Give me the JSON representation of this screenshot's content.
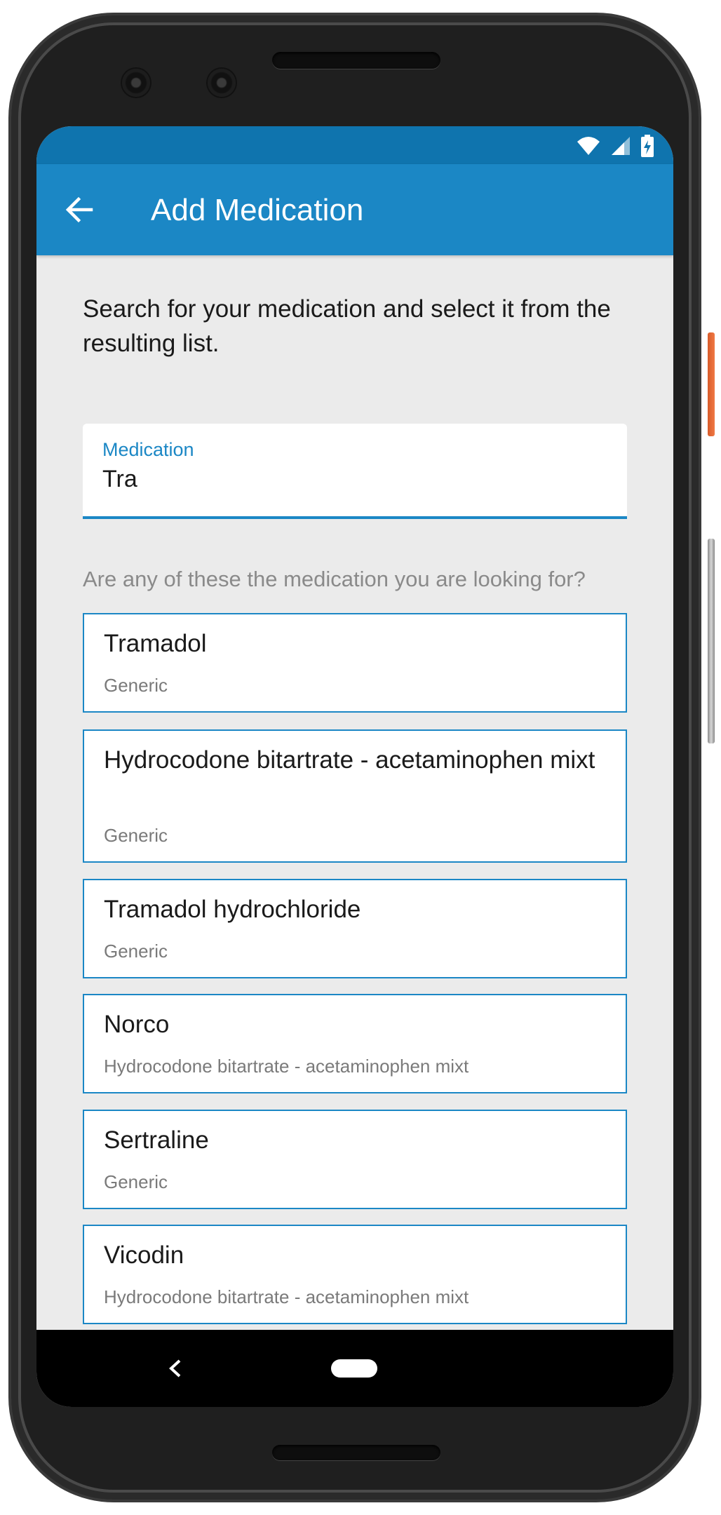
{
  "app_bar": {
    "title": "Add Medication",
    "back_icon": "arrow-left-icon"
  },
  "status_bar": {
    "icons": [
      "wifi-icon",
      "cell-signal-icon",
      "battery-charging-icon"
    ],
    "color": "#0f74ae"
  },
  "instructions": "Search for your medication and select it from the resulting list.",
  "search": {
    "label": "Medication",
    "value": "Tra"
  },
  "prompt": "Are any of these the medication you are looking for?",
  "results": [
    {
      "name": "Tramadol",
      "subtitle": "Generic"
    },
    {
      "name": "Hydrocodone bitartrate - acetaminophen mixt",
      "subtitle": "Generic"
    },
    {
      "name": "Tramadol hydrochloride",
      "subtitle": "Generic"
    },
    {
      "name": "Norco",
      "subtitle": "Hydrocodone bitartrate - acetaminophen mixt"
    },
    {
      "name": "Sertraline",
      "subtitle": "Generic"
    },
    {
      "name": "Vicodin",
      "subtitle": "Hydrocodone bitartrate - acetaminophen mixt"
    }
  ],
  "nav_bar": {
    "back_icon": "nav-back-icon",
    "home_icon": "nav-home-pill-icon"
  },
  "colors": {
    "primary": "#1b87c5",
    "primary_dark": "#0f74ae",
    "background": "#ebebeb",
    "subtitle_gray": "#7a7a7a"
  }
}
